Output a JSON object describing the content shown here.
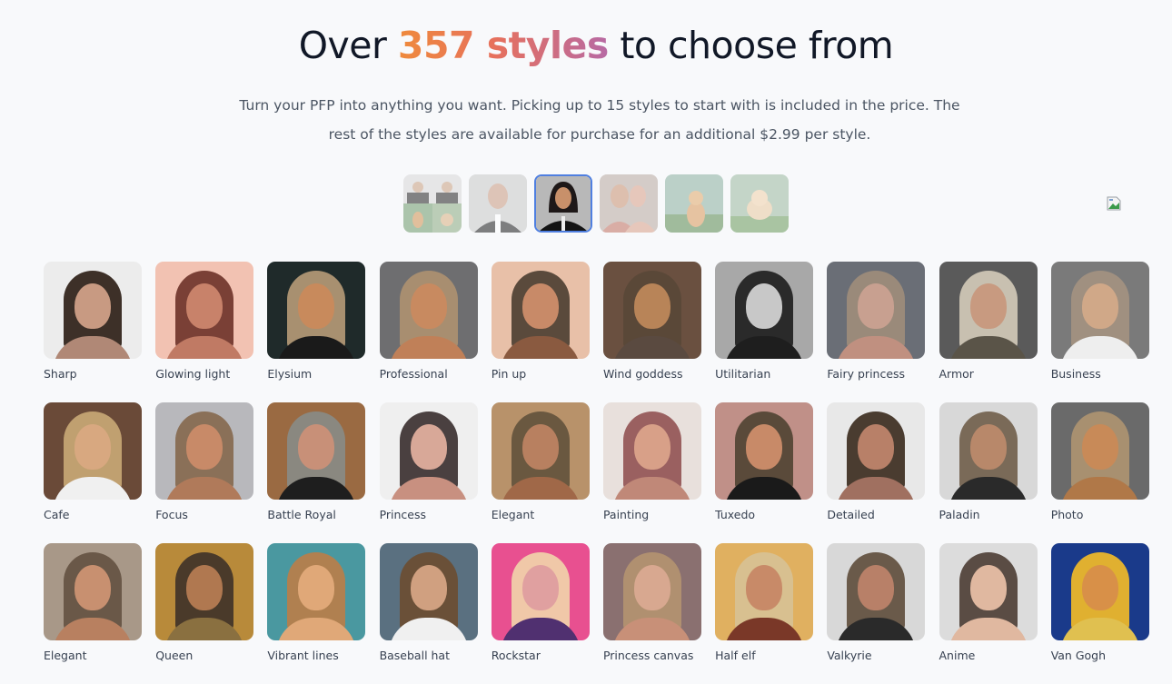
{
  "header": {
    "title_prefix": "Over ",
    "title_highlight": "357 styles",
    "title_suffix": " to choose from",
    "description": "Turn your PFP into anything you want. Picking up to 15 styles to start with is included in the price. The rest of the styles are available for purchase for an additional $2.99 per style."
  },
  "colors": {
    "gradient_start": "#ef8a3c",
    "gradient_end": "#b76aa4",
    "active_border": "#4f7fe0"
  },
  "subject_thumbnails": [
    {
      "name": "collage",
      "active": false
    },
    {
      "name": "man-tuxedo",
      "active": false
    },
    {
      "name": "woman-tuxedo",
      "active": true
    },
    {
      "name": "couple",
      "active": false
    },
    {
      "name": "cat",
      "active": false
    },
    {
      "name": "dog",
      "active": false
    }
  ],
  "broken_image_icon": "broken-image-icon",
  "styles": [
    {
      "label": "Sharp",
      "bg": "#ececec",
      "hair": "#3d3028",
      "skin": "#c89a82",
      "cloth": "#b08876"
    },
    {
      "label": "Glowing light",
      "bg": "#f2c2b2",
      "hair": "#7a4036",
      "skin": "#c8826a",
      "cloth": "#c07a64"
    },
    {
      "label": "Elysium",
      "bg": "#1f2a2a",
      "hair": "#a89070",
      "skin": "#c88a5c",
      "cloth": "#1a1a1a"
    },
    {
      "label": "Professional",
      "bg": "#6e6e70",
      "hair": "#a88e70",
      "skin": "#c88a60",
      "cloth": "#c08058"
    },
    {
      "label": "Pin up",
      "bg": "#e8c0a8",
      "hair": "#5a4a3c",
      "skin": "#c88a68",
      "cloth": "#8a5a40"
    },
    {
      "label": "Wind goddess",
      "bg": "#6a5040",
      "hair": "#5a4838",
      "skin": "#b88458",
      "cloth": "#5a4a40"
    },
    {
      "label": "Utilitarian",
      "bg": "#a8a8a8",
      "hair": "#2a2a2a",
      "skin": "#c8c8c8",
      "cloth": "#1e1e1e"
    },
    {
      "label": "Fairy princess",
      "bg": "#6a6e76",
      "hair": "#9a8a7a",
      "skin": "#c8a090",
      "cloth": "#c09080"
    },
    {
      "label": "Armor",
      "bg": "#5a5a5a",
      "hair": "#c8c0b0",
      "skin": "#c89a80",
      "cloth": "#5a5448"
    },
    {
      "label": "Business",
      "bg": "#7a7a7a",
      "hair": "#a09080",
      "skin": "#d0a888",
      "cloth": "#eeeeee"
    },
    {
      "label": "Cafe",
      "bg": "#6a4a38",
      "hair": "#c0a070",
      "skin": "#d8a880",
      "cloth": "#f0f0f0"
    },
    {
      "label": "Focus",
      "bg": "#b8b8bc",
      "hair": "#8a7058",
      "skin": "#c88a68",
      "cloth": "#b07a5a"
    },
    {
      "label": "Battle Royal",
      "bg": "#9a6a42",
      "hair": "#8a8880",
      "skin": "#c89078",
      "cloth": "#1e1e1e"
    },
    {
      "label": "Princess",
      "bg": "#efefef",
      "hair": "#4a4040",
      "skin": "#d8a898",
      "cloth": "#c89080"
    },
    {
      "label": "Elegant",
      "bg": "#b8926a",
      "hair": "#6a5840",
      "skin": "#b88060",
      "cloth": "#a06848"
    },
    {
      "label": "Painting",
      "bg": "#e8e0dc",
      "hair": "#9a6060",
      "skin": "#d8a088",
      "cloth": "#c08878"
    },
    {
      "label": "Tuxedo",
      "bg": "#c09088",
      "hair": "#5a4a3a",
      "skin": "#c88a68",
      "cloth": "#1a1a1a"
    },
    {
      "label": "Detailed",
      "bg": "#e8e8e8",
      "hair": "#4a3c30",
      "skin": "#b88068",
      "cloth": "#a07060"
    },
    {
      "label": "Paladin",
      "bg": "#d8d8d8",
      "hair": "#7a6a58",
      "skin": "#b8886a",
      "cloth": "#2a2a2a"
    },
    {
      "label": "Photo",
      "bg": "#6a6a6a",
      "hair": "#a89070",
      "skin": "#c88a58",
      "cloth": "#b07848"
    },
    {
      "label": "Elegant",
      "bg": "#a89888",
      "hair": "#6a5848",
      "skin": "#c89070",
      "cloth": "#b88060"
    },
    {
      "label": "Queen",
      "bg": "#b88a3a",
      "hair": "#4a3a2a",
      "skin": "#b07850",
      "cloth": "#8a7040"
    },
    {
      "label": "Vibrant lines",
      "bg": "#4a98a0",
      "hair": "#b08050",
      "skin": "#e0a878",
      "cloth": "#e0a878"
    },
    {
      "label": "Baseball hat",
      "bg": "#5a7080",
      "hair": "#6a5038",
      "skin": "#d0a080",
      "cloth": "#f0f0f0"
    },
    {
      "label": "Rockstar",
      "bg": "#e85090",
      "hair": "#f0c8a8",
      "skin": "#e0a0a0",
      "cloth": "#503070"
    },
    {
      "label": "Princess canvas",
      "bg": "#8a7070",
      "hair": "#b09070",
      "skin": "#d8a890",
      "cloth": "#c89078"
    },
    {
      "label": "Half elf",
      "bg": "#e0b060",
      "hair": "#d8c090",
      "skin": "#c88a68",
      "cloth": "#7a3828"
    },
    {
      "label": "Valkyrie",
      "bg": "#d8d8d8",
      "hair": "#6a5a4a",
      "skin": "#b88068",
      "cloth": "#2a2a2a"
    },
    {
      "label": "Anime",
      "bg": "#dcdcdc",
      "hair": "#5a4c44",
      "skin": "#e0b8a0",
      "cloth": "#e0b8a0"
    },
    {
      "label": "Van Gogh",
      "bg": "#1a3a8a",
      "hair": "#e0b030",
      "skin": "#d89048",
      "cloth": "#e0c050"
    }
  ]
}
